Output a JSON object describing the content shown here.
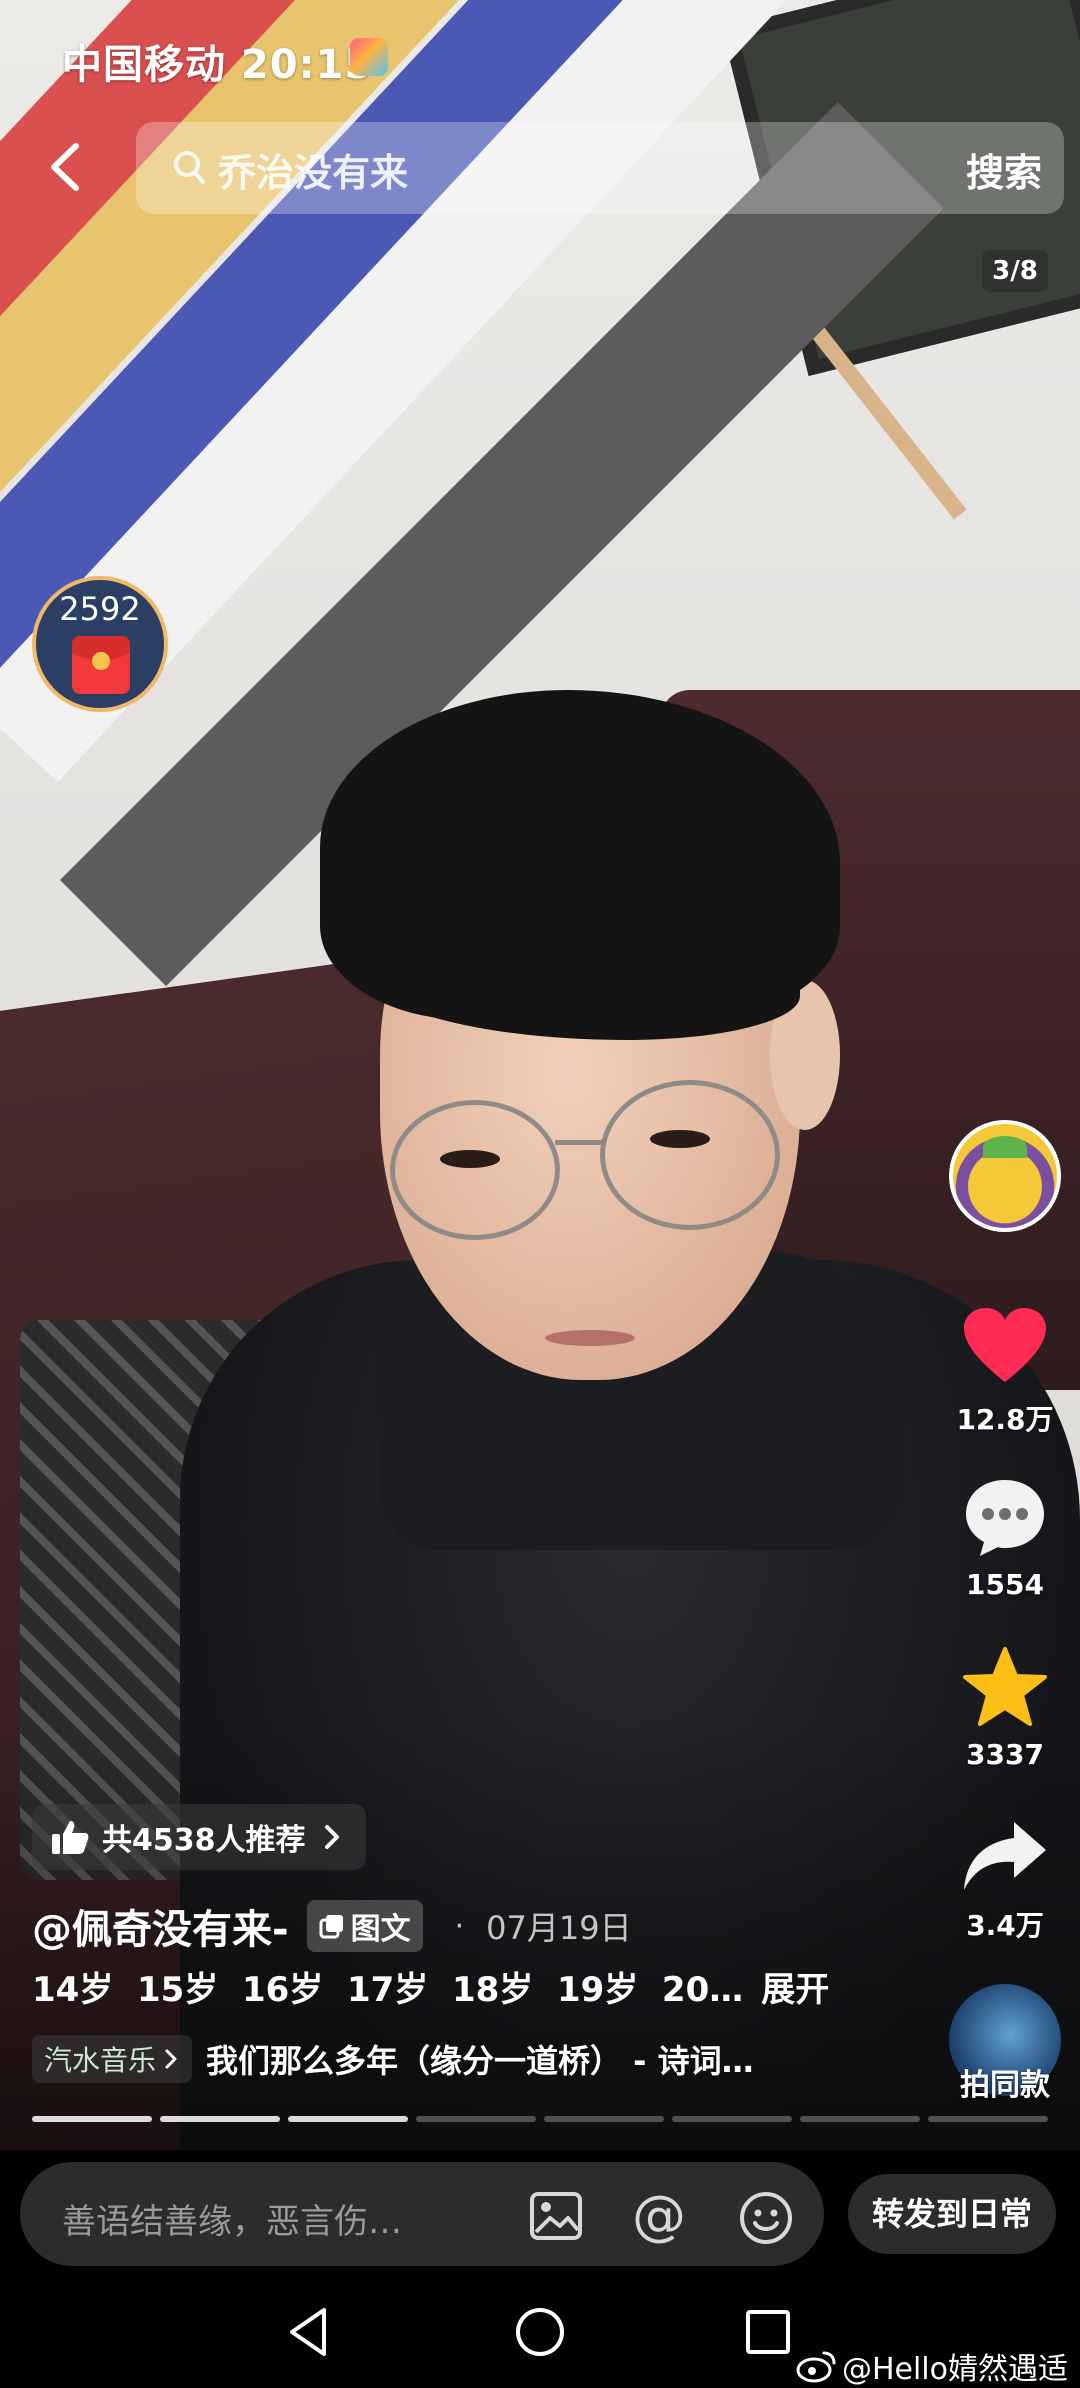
{
  "status_bar": {
    "carrier_time": "中国移动 20:15"
  },
  "search": {
    "query": "乔治没有来",
    "button_label": "搜索"
  },
  "page_indicator": "3/8",
  "red_packet": {
    "count": "2592"
  },
  "right_rail": {
    "like_count": "12.8万",
    "comment_count": "1554",
    "favorite_count": "3337",
    "share_count": "3.4万",
    "same_style_label": "拍同款"
  },
  "post": {
    "recommend_label": "共4538人推荐",
    "author": "@佩奇没有来-",
    "badge": "图文",
    "date_separator": "·",
    "date": "07月19日",
    "caption": "14岁  15岁  16岁  17岁  18岁  19岁  20…",
    "expand_label": "展开",
    "music_tag": "汽水音乐",
    "music_title": "我们那么多年（缘分一道桥） - 诗词…"
  },
  "progress": {
    "total_segments": 8,
    "current": 3
  },
  "comment_bar": {
    "placeholder": "善语结善缘，恶言伤…",
    "at_symbol": "@",
    "repost_label": "转发到日常"
  },
  "watermark": "@Hello婧然遇适",
  "colors": {
    "like": "#fe2c55",
    "favorite": "#fcbf16",
    "red_packet": "#f23a3a"
  }
}
